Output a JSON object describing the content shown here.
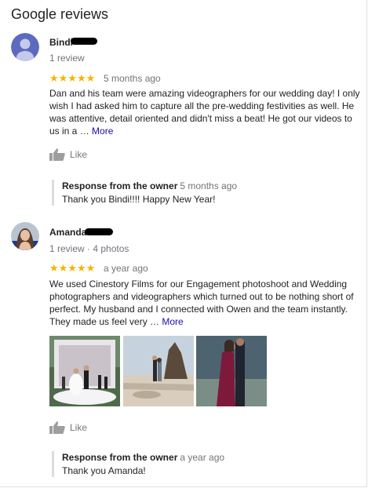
{
  "title": "Google reviews",
  "reviews": [
    {
      "name": "Bindi",
      "meta": "1 review",
      "stars": "★★★★★",
      "when": "5 months ago",
      "text": "Dan and his team were amazing videographers for our wedding day! I only wish I had asked him to capture all the pre-wedding festivities as well. He was attentive, detail oriented and didn't miss a beat! He got our videos to us in a … ",
      "more": "More",
      "like": "Like",
      "response_owner": "Response from the owner",
      "response_when": "5 months ago",
      "response_text": "Thank you Bindi!!!! Happy New Year!"
    },
    {
      "name": "Amanda",
      "meta": "1 review · 4 photos",
      "stars": "★★★★★",
      "when": "a year ago",
      "text": "We used Cinestory Films for our Engagement photoshoot and Wedding photographers and videographers which turned out to be nothing short of perfect. My husband and I connected with Owen and the team instantly. They made us feel very … ",
      "more": "More",
      "like": "Like",
      "response_owner": "Response from the owner",
      "response_when": "a year ago",
      "response_text": "Thank you Amanda!"
    }
  ],
  "colors": {
    "star": "#f4b400",
    "link": "#1a0dab",
    "muted": "#70757a",
    "avatar1": "#5c6bc0"
  }
}
